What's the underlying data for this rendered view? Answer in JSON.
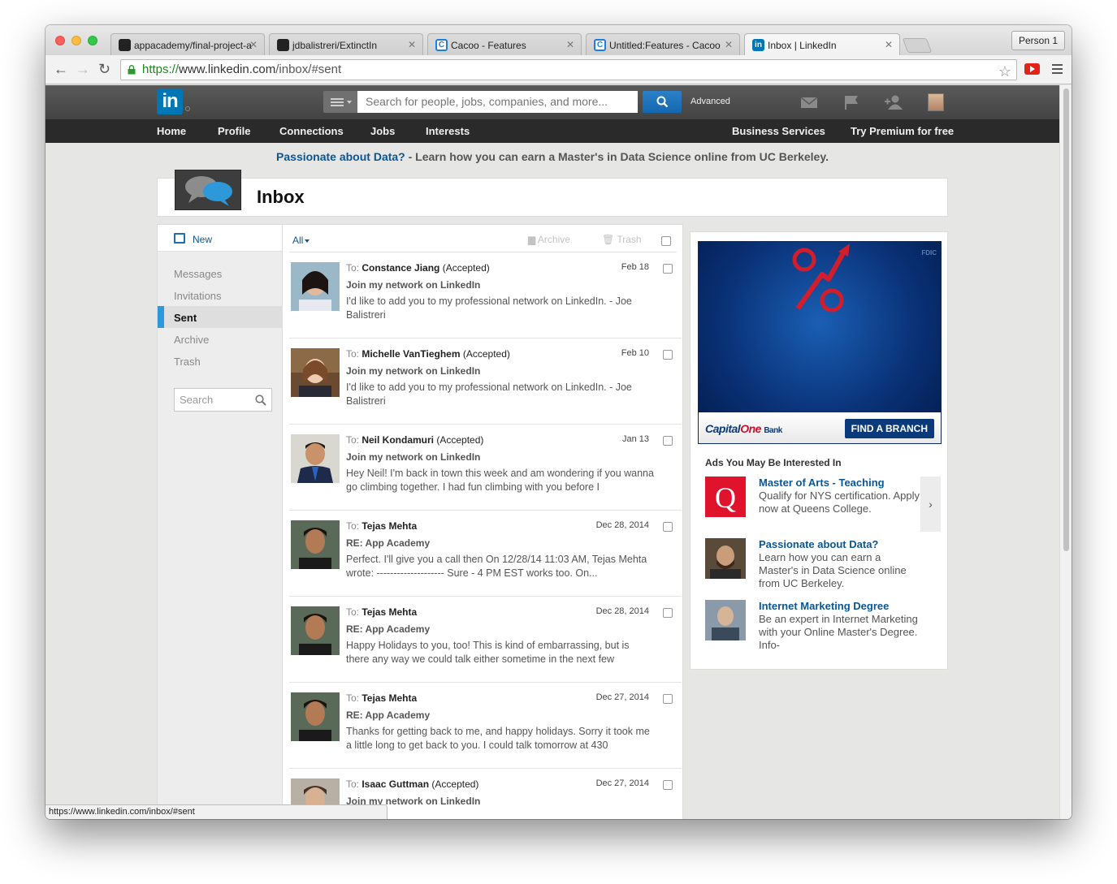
{
  "browser": {
    "tabs": [
      {
        "label": "appacademy/final-project-a",
        "icon": "github-icon"
      },
      {
        "label": "jdbalistreri/ExtinctIn",
        "icon": "github-icon"
      },
      {
        "label": "Cacoo - Features",
        "icon": "cacoo-icon"
      },
      {
        "label": "Untitled:Features - Cacoo",
        "icon": "cacoo-icon"
      },
      {
        "label": "Inbox | LinkedIn",
        "icon": "linkedin-icon"
      }
    ],
    "profile_label": "Person 1",
    "url_scheme": "https://",
    "url_host": "www.linkedin.com",
    "url_path": "/inbox/#sent",
    "status_url": "https://www.linkedin.com/inbox/#sent"
  },
  "header": {
    "logo_text": "in",
    "search_placeholder": "Search for people, jobs, companies, and more...",
    "advanced_label": "Advanced",
    "nav": [
      "Home",
      "Profile",
      "Connections",
      "Jobs",
      "Interests"
    ],
    "nav_right": [
      "Business Services",
      "Try Premium for free"
    ]
  },
  "promo": {
    "link_text": "Passionate about Data?",
    "rest_text": " - Learn how you can earn a Master's in Data Science online from UC Berkeley."
  },
  "inbox": {
    "title": "Inbox",
    "new_label": "New",
    "folders": [
      "Messages",
      "Invitations",
      "Sent",
      "Archive",
      "Trash"
    ],
    "active_folder": "Sent",
    "search_placeholder": "Search",
    "filter_label": "All",
    "archive_label": "Archive",
    "trash_label": "Trash",
    "messages": [
      {
        "to_prefix": "To: ",
        "name": "Constance Jiang",
        "status": "(Accepted)",
        "date": "Feb 18",
        "subject": "Join my network on LinkedIn",
        "body": "I'd like to add you to my professional network on LinkedIn. - Joe Balistreri"
      },
      {
        "to_prefix": "To: ",
        "name": "Michelle VanTieghem",
        "status": "(Accepted)",
        "date": "Feb 10",
        "subject": "Join my network on LinkedIn",
        "body": "I'd like to add you to my professional network on LinkedIn. - Joe Balistreri"
      },
      {
        "to_prefix": "To: ",
        "name": "Neil Kondamuri",
        "status": "(Accepted)",
        "date": "Jan 13",
        "subject": "Join my network on LinkedIn",
        "body": "Hey Neil! I'm back in town this week and am wondering if you wanna go climbing together. I had fun climbing with you before I"
      },
      {
        "to_prefix": "To: ",
        "name": "Tejas Mehta",
        "status": "",
        "date": "Dec 28, 2014",
        "subject": "RE: App Academy",
        "body": "Perfect. I'll give you a call then On 12/28/14 11:03 AM, Tejas Mehta wrote: -------------------- Sure - 4 PM EST works too. On..."
      },
      {
        "to_prefix": "To: ",
        "name": "Tejas Mehta",
        "status": "",
        "date": "Dec 28, 2014",
        "subject": "RE: App Academy",
        "body": "Happy Holidays to you, too! This is kind of embarrassing, but is there any way we could talk either sometime in the next few"
      },
      {
        "to_prefix": "To: ",
        "name": "Tejas Mehta",
        "status": "",
        "date": "Dec 27, 2014",
        "subject": "RE: App Academy",
        "body": "Thanks for getting back to me, and happy holidays. Sorry it took me a little long to get back to you. I could talk tomorrow at 430"
      },
      {
        "to_prefix": "To: ",
        "name": "Isaac Guttman",
        "status": "(Accepted)",
        "date": "Dec 27, 2014",
        "subject": "Join my network on LinkedIn",
        "body": ""
      }
    ]
  },
  "ads": {
    "bank_fdic": "FDIC",
    "bank_logo": "Capital",
    "bank_logo_one": "One",
    "bank_logo_suffix": "Bank",
    "bank_cta": "FIND A BRANCH",
    "section_title": "Ads You May Be Interested In",
    "next_label": "›",
    "items": [
      {
        "title": "Master of Arts - Teaching",
        "text": "Qualify for NYS certification. Apply now at Queens College."
      },
      {
        "title": "Passionate about Data?",
        "text": "Learn how you can earn a Master's in Data Science online from UC Berkeley."
      },
      {
        "title": "Internet Marketing Degree",
        "text": "Be an expert in Internet Marketing with your Online Master's Degree. Info-"
      }
    ]
  },
  "colors": {
    "linkedin_blue": "#0077b5",
    "link": "#0a5694",
    "active_folder_bar": "#2d98da"
  }
}
